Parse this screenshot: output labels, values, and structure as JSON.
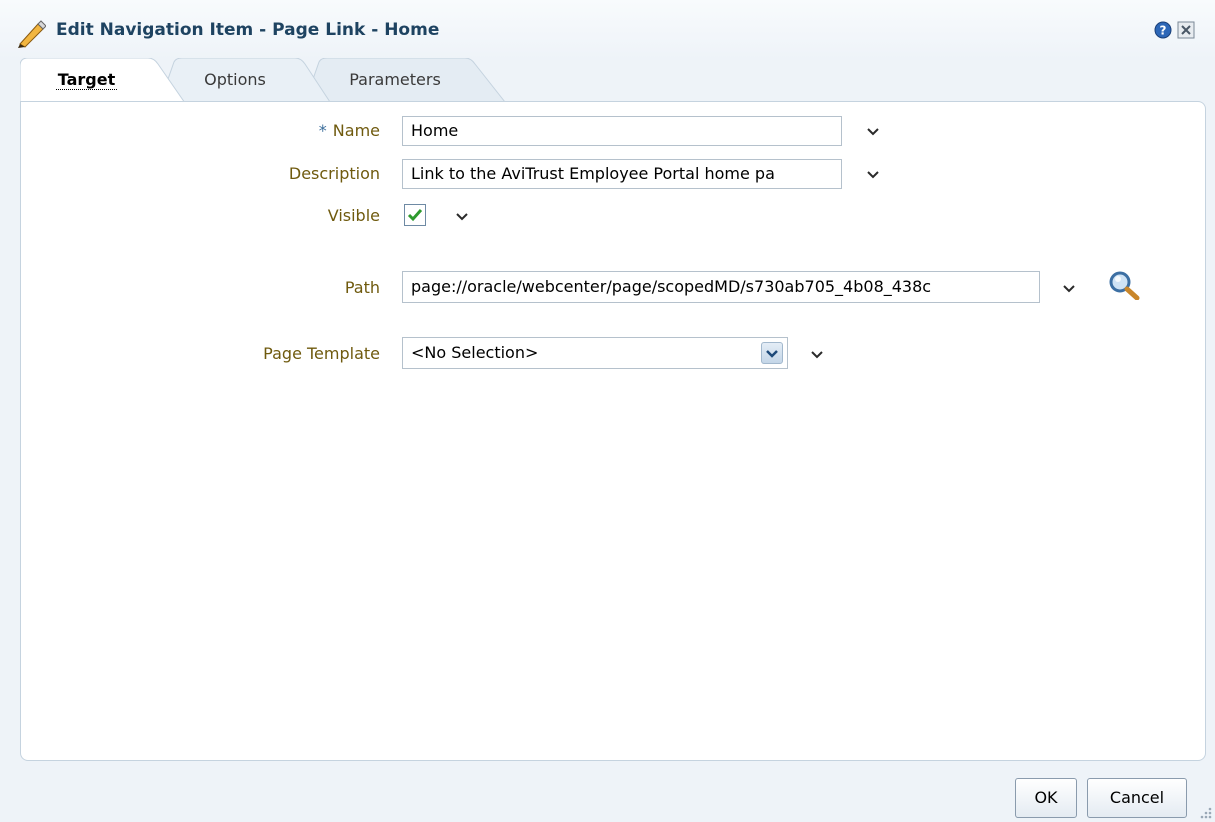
{
  "dialog": {
    "title": "Edit Navigation Item - Page Link - Home",
    "icons": {
      "title": "pencil-icon",
      "help": "help-icon",
      "close": "close-icon"
    }
  },
  "tabs": [
    {
      "label": "Target",
      "active": true
    },
    {
      "label": "Options",
      "active": false
    },
    {
      "label": "Parameters",
      "active": false
    }
  ],
  "form": {
    "required_marker": "*",
    "name": {
      "label": "Name",
      "value": "Home"
    },
    "description": {
      "label": "Description",
      "value": "Link to the AviTrust Employee Portal home pa"
    },
    "visible": {
      "label": "Visible",
      "checked": true
    },
    "path": {
      "label": "Path",
      "value": "page://oracle/webcenter/page/scopedMD/s730ab705_4b08_438c"
    },
    "page_template": {
      "label": "Page Template",
      "selected": "<No Selection>"
    }
  },
  "footer": {
    "ok_label": "OK",
    "cancel_label": "Cancel"
  },
  "colors": {
    "label": "#6f5a0e",
    "title": "#1e4361",
    "check": "#2e9a2e"
  }
}
